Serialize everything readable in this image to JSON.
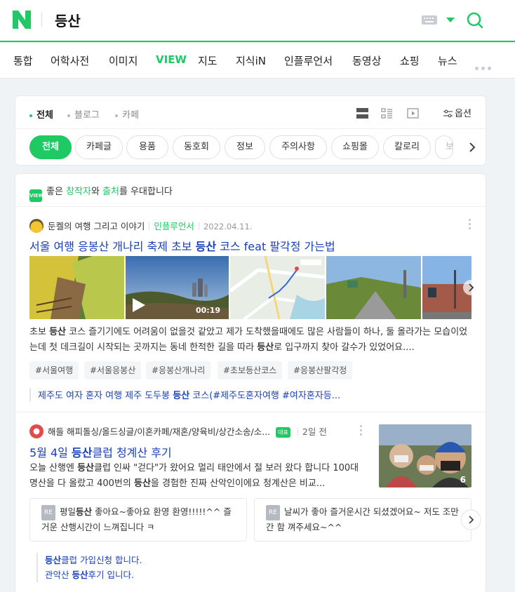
{
  "header": {
    "query": "등산",
    "colors": {
      "brand": "#1fc964",
      "link": "#1a3fb8"
    }
  },
  "tabs": [
    {
      "label": "통합"
    },
    {
      "label": "어학사전"
    },
    {
      "label": "이미지"
    },
    {
      "label": "VIEW",
      "active": true
    },
    {
      "label": "지도"
    },
    {
      "label": "지식iN"
    },
    {
      "label": "인플루언서"
    },
    {
      "label": "동영상"
    },
    {
      "label": "쇼핑"
    },
    {
      "label": "뉴스"
    }
  ],
  "filter": {
    "subtabs": [
      {
        "label": "전체",
        "active": true
      },
      {
        "label": "블로그"
      },
      {
        "label": "카페"
      }
    ],
    "options_label": "옵션",
    "chips": [
      {
        "label": "전체",
        "active": true
      },
      {
        "label": "카페글"
      },
      {
        "label": "용품"
      },
      {
        "label": "동호회"
      },
      {
        "label": "정보"
      },
      {
        "label": "주의사항"
      },
      {
        "label": "쇼핑몰"
      },
      {
        "label": "칼로리"
      },
      {
        "label": "보"
      }
    ]
  },
  "promo": {
    "badge": "VIEW",
    "pre": "좋은 ",
    "creator": "창작자",
    "mid": "와 ",
    "source": "출처",
    "post": "를 우대합니다"
  },
  "result1": {
    "author": "둔켈의 여행 그리고 이야기",
    "author_type": "인플루언서",
    "date": "2022.04.11.",
    "title_pre": "서울 여행 응봉산 개나리 축제 초보 ",
    "title_kw": "등산",
    "title_post": " 코스 feat 팔각정 가는법",
    "video_duration": "00:19",
    "desc_1": "초보 ",
    "desc_kw1": "등산",
    "desc_2": " 코스 즐기기에도 어려움이 없을것 같았고 제가 도착했을때에도 많은 사람들이 하나, 둘 올라가는 모습이었는데 첫 데크길이 시작되는 곳까지는 동네 한적한 길을 따라 ",
    "desc_kw2": "등산",
    "desc_3": "로 입구까지 찾아 갈수가 있었어요....",
    "tags": [
      "#서울여행",
      "#서울응봉산",
      "#응봉산개나리",
      "#초보등산코스",
      "#응봉산팔각정"
    ],
    "related_pre": "제주도 여자 혼자 여행 제주 도두봉 ",
    "related_kw": "등산",
    "related_post": " 코스(#제주도혼자여행 #여자혼자등..."
  },
  "result2": {
    "author": "해들 해피돌싱/올드싱글/이혼카페/재혼/양육비/상간소송/소...",
    "badge": "대표",
    "date": "2일 전",
    "title_pre": "5월 4일 ",
    "title_kw": "등산",
    "title_post": "클럽 청계산 후기",
    "desc_1": "오늘 산행엔 ",
    "desc_kw1": "등산",
    "desc_2": "클럽 인싸 \"걷다\"가 왔어요 멀리 태안에서 절 보러 왔다 합니다 100대 명산을 다 올랐고 400번의 ",
    "desc_kw2": "등산",
    "desc_3": "을 경험한 진짜 산악인이에요 청계산은 비교...",
    "photo_count": "6",
    "replies": [
      {
        "re": "RE",
        "pre": "평일",
        "kw": "등산",
        "post": " 좋아요~좋아요 환영 환영!!!!!^^ 즐거운 산행시간이 느껴집니다 ㅋ"
      },
      {
        "re": "RE",
        "pre": "날씨가 좋아 즐거운시간 되셨겠어요~ 저도 조만간 함 껴주세요~^^",
        "kw": "",
        "post": ""
      }
    ],
    "link1_kw": "등산",
    "link1_post": "클럽 가입신청 합니다.",
    "link2_pre": "관악산 ",
    "link2_kw": "등산",
    "link2_post": "후기 입니다."
  }
}
